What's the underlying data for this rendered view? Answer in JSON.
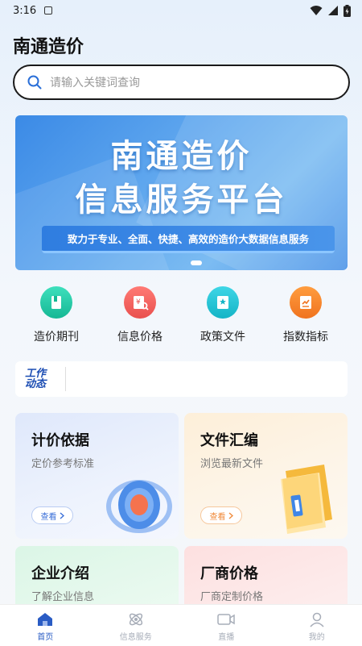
{
  "status_bar": {
    "time": "3:16"
  },
  "header": {
    "title": "南通造价"
  },
  "search": {
    "placeholder": "请输入关键词查询"
  },
  "banner": {
    "line1": "南通造价",
    "line2": "信息服务平台",
    "tagline": "致力于专业、全面、快捷、高效的造价大数据信息服务"
  },
  "quick_nav": [
    {
      "label": "造价期刊",
      "icon": "journal-icon",
      "color": "#1ecba6"
    },
    {
      "label": "信息价格",
      "icon": "price-info-icon",
      "color": "#f0605e"
    },
    {
      "label": "政策文件",
      "icon": "policy-document-icon",
      "color": "#1dbfd0"
    },
    {
      "label": "指数指标",
      "icon": "index-chart-icon",
      "color": "#f5822a"
    }
  ],
  "news": {
    "logo_top": "工作",
    "logo_bottom": "动态"
  },
  "cards": [
    {
      "title": "计价依据",
      "subtitle": "定价参考标准",
      "button": "查看",
      "accent": "#3a6fd8"
    },
    {
      "title": "文件汇编",
      "subtitle": "浏览最新文件",
      "button": "查看",
      "accent": "#f08a3a"
    },
    {
      "title": "企业介绍",
      "subtitle": "了解企业信息"
    },
    {
      "title": "厂商价格",
      "subtitle": "厂商定制价格"
    }
  ],
  "tabs": [
    {
      "label": "首页",
      "icon": "home-icon",
      "active": true
    },
    {
      "label": "信息服务",
      "icon": "info-service-icon",
      "active": false
    },
    {
      "label": "直播",
      "icon": "live-video-icon",
      "active": false
    },
    {
      "label": "我的",
      "icon": "profile-icon",
      "active": false
    }
  ]
}
